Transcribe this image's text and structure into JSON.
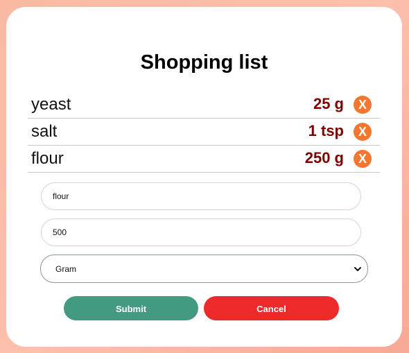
{
  "title": "Shopping list",
  "items": [
    {
      "name": "yeast",
      "quantity": "25 g",
      "delete_label": "X"
    },
    {
      "name": "salt",
      "quantity": "1 tsp",
      "delete_label": "X"
    },
    {
      "name": "flour",
      "quantity": "250 g",
      "delete_label": "X"
    }
  ],
  "form": {
    "name_value": "flour",
    "amount_value": "500",
    "unit_selected": "Gram",
    "submit_label": "Submit",
    "cancel_label": "Cancel"
  },
  "colors": {
    "quantity": "#800000",
    "delete_button": "#f5772f",
    "submit": "#439b7f",
    "cancel": "#ec2a2a"
  },
  "icons": {
    "delete": "close-icon",
    "select_arrow": "chevron-down-icon"
  }
}
